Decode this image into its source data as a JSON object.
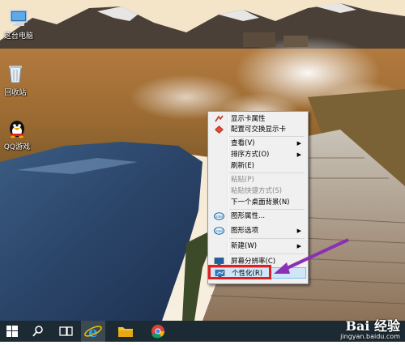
{
  "desktop": {
    "icons": [
      {
        "label": "这台电脑",
        "icon": "computer-icon"
      },
      {
        "label": "回收站",
        "icon": "recycle-bin-icon"
      },
      {
        "label": "QQ游戏",
        "icon": "qq-game-icon"
      }
    ]
  },
  "context_menu": {
    "items": [
      {
        "label": "显示卡属性",
        "icon": "graphics-card-icon",
        "enabled": true,
        "submenu": false
      },
      {
        "label": "配置可交换显示卡",
        "icon": "switchable-graphics-icon",
        "enabled": true,
        "submenu": false
      },
      {
        "label": "查看(V)",
        "enabled": true,
        "submenu": true
      },
      {
        "label": "排序方式(O)",
        "enabled": true,
        "submenu": true
      },
      {
        "label": "刷新(E)",
        "enabled": true,
        "submenu": false
      },
      {
        "label": "粘贴(P)",
        "enabled": false,
        "submenu": false
      },
      {
        "label": "粘贴快捷方式(S)",
        "enabled": false,
        "submenu": false
      },
      {
        "label": "下一个桌面背景(N)",
        "enabled": true,
        "submenu": false
      },
      {
        "label": "图形属性...",
        "icon": "intel-icon",
        "enabled": true,
        "submenu": false
      },
      {
        "label": "图形选项",
        "icon": "intel-icon",
        "enabled": true,
        "submenu": true
      },
      {
        "label": "新建(W)",
        "enabled": true,
        "submenu": true
      },
      {
        "label": "屏幕分辨率(C)",
        "icon": "display-icon",
        "enabled": true,
        "submenu": false
      },
      {
        "label": "个性化(R)",
        "icon": "personalize-icon",
        "enabled": true,
        "submenu": false
      }
    ],
    "submenu_arrow": "▶",
    "highlight_color": "#e02020",
    "arrow_color": "#8b2fb5"
  },
  "taskbar": {
    "buttons": [
      {
        "name": "start-button",
        "icon": "windows-logo-icon"
      },
      {
        "name": "search-button",
        "icon": "search-icon"
      },
      {
        "name": "task-view-button",
        "icon": "task-view-icon"
      },
      {
        "name": "internet-explorer-button",
        "icon": "ie-icon"
      },
      {
        "name": "file-explorer-button",
        "icon": "folder-icon"
      },
      {
        "name": "chrome-button",
        "icon": "chrome-icon"
      }
    ]
  },
  "watermark": {
    "line1": "Bai 经验",
    "line2": "jingyan.baidu.com"
  }
}
